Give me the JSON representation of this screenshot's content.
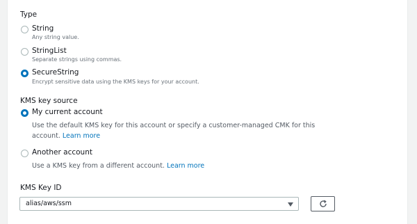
{
  "type_section": {
    "label": "Type",
    "options": [
      {
        "title": "String",
        "description": "Any string value.",
        "selected": false
      },
      {
        "title": "StringList",
        "description": "Separate strings using commas.",
        "selected": false
      },
      {
        "title": "SecureString",
        "description": "Encrypt sensitive data using the KMS keys for your account.",
        "selected": true
      }
    ]
  },
  "kms_source": {
    "label": "KMS key source",
    "options": [
      {
        "title": "My current account",
        "description": "Use the default KMS key for this account or specify a customer-managed CMK for this account.",
        "link": "Learn more",
        "selected": true
      },
      {
        "title": "Another account",
        "description": "Use a KMS key from a different account.",
        "link": "Learn more",
        "selected": false
      }
    ]
  },
  "kms_key_id": {
    "label": "KMS Key ID",
    "value": "alias/aws/ssm",
    "refresh_icon": "refresh-icon",
    "caret_icon": "caret-down-icon"
  },
  "colors": {
    "accent": "#0073bb",
    "text": "#16191f",
    "muted": "#687078"
  }
}
